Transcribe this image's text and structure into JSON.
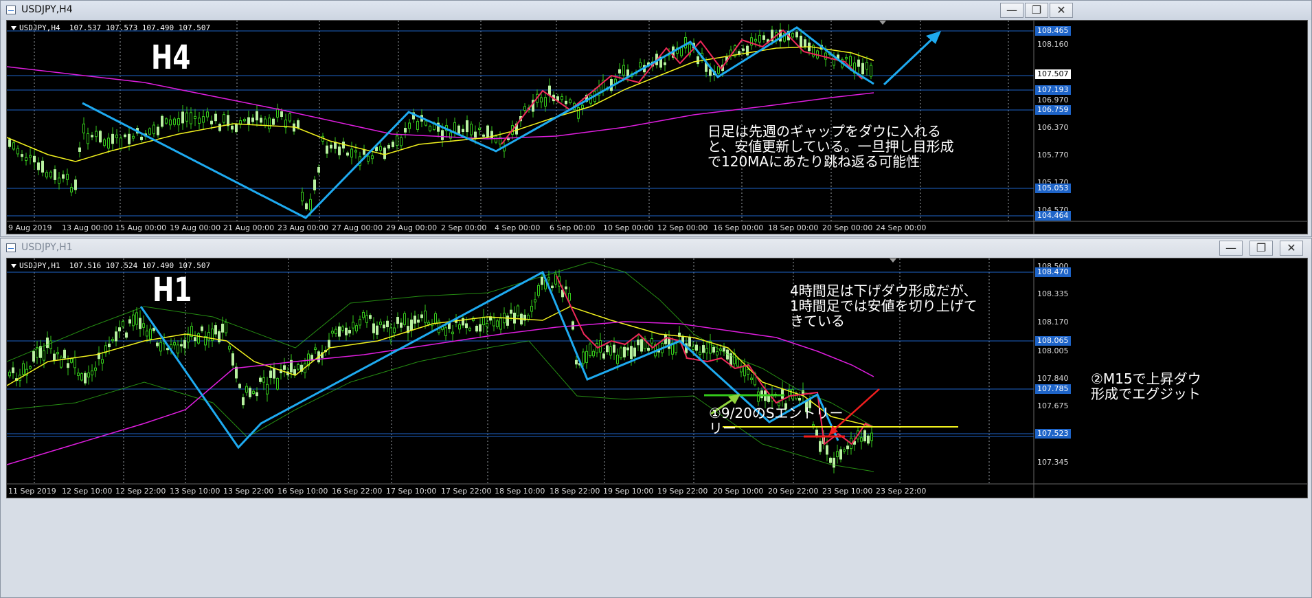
{
  "windows": [
    {
      "title": "USDJPY,H4",
      "header": "USDJPY,H4  107.537 107.573 107.490 107.507",
      "timeframe_label": "H4",
      "note": "日足は先週のギャップをダウに入れる\nと、安値更新している。一旦押し目形成\nで120MAにあたり跳ね返る可能性",
      "price_labels": [
        {
          "text": "108.465",
          "style": "hl"
        },
        {
          "text": "108.160",
          "style": "plain"
        },
        {
          "text": "107.507",
          "style": "cur"
        },
        {
          "text": "107.193",
          "style": "hl"
        },
        {
          "text": "106.970",
          "style": "plain"
        },
        {
          "text": "106.759",
          "style": "hl"
        },
        {
          "text": "106.370",
          "style": "plain"
        },
        {
          "text": "105.770",
          "style": "plain"
        },
        {
          "text": "105.170",
          "style": "plain"
        },
        {
          "text": "105.053",
          "style": "hl"
        },
        {
          "text": "104.570",
          "style": "plain"
        },
        {
          "text": "104.464",
          "style": "hl"
        }
      ],
      "time_labels": [
        "9 Aug 2019",
        "13 Aug 00:00",
        "15 Aug 00:00",
        "19 Aug 00:00",
        "21 Aug 00:00",
        "23 Aug 00:00",
        "27 Aug 00:00",
        "29 Aug 00:00",
        "2 Sep 00:00",
        "4 Sep 00:00",
        "6 Sep 00:00",
        "10 Sep 00:00",
        "12 Sep 00:00",
        "16 Sep 00:00",
        "18 Sep 00:00",
        "20 Sep 00:00",
        "24 Sep 00:00"
      ]
    },
    {
      "title": "USDJPY,H1",
      "header": "USDJPY,H1  107.516 107.524 107.490 107.507",
      "timeframe_label": "H1",
      "note": "4時間足は下げダウ形成だが、\n1時間足では安値を切り上げて\nきている",
      "note_entry": "①9/20のSエントリー\nリー",
      "note_exit": "②M15で上昇ダウ\n形成でエグジット",
      "price_labels": [
        {
          "text": "108.500",
          "style": "plain"
        },
        {
          "text": "108.470",
          "style": "hl"
        },
        {
          "text": "108.335",
          "style": "plain"
        },
        {
          "text": "108.170",
          "style": "plain"
        },
        {
          "text": "108.065",
          "style": "hl"
        },
        {
          "text": "108.005",
          "style": "plain"
        },
        {
          "text": "107.840",
          "style": "plain"
        },
        {
          "text": "107.785",
          "style": "hl"
        },
        {
          "text": "107.675",
          "style": "plain"
        },
        {
          "text": "107.523",
          "style": "hl"
        },
        {
          "text": "107.345",
          "style": "plain"
        }
      ],
      "time_labels": [
        "11 Sep 2019",
        "12 Sep 10:00",
        "12 Sep 22:00",
        "13 Sep 10:00",
        "13 Sep 22:00",
        "16 Sep 10:00",
        "16 Sep 22:00",
        "17 Sep 10:00",
        "17 Sep 22:00",
        "18 Sep 10:00",
        "18 Sep 22:00",
        "19 Sep 10:00",
        "19 Sep 22:00",
        "20 Sep 10:00",
        "20 Sep 22:00",
        "23 Sep 10:00",
        "23 Sep 22:00"
      ]
    }
  ],
  "buttons": {
    "minimize": "—",
    "restore": "❐",
    "close": "✕"
  },
  "colors": {
    "cyan": "#1eaaf0",
    "yellow": "#f2f21e",
    "magenta": "#e01ee0",
    "red": "#f0285a",
    "green": "#34c81a",
    "grid": "#9aa0a6",
    "hline": "#1e64c8"
  }
}
